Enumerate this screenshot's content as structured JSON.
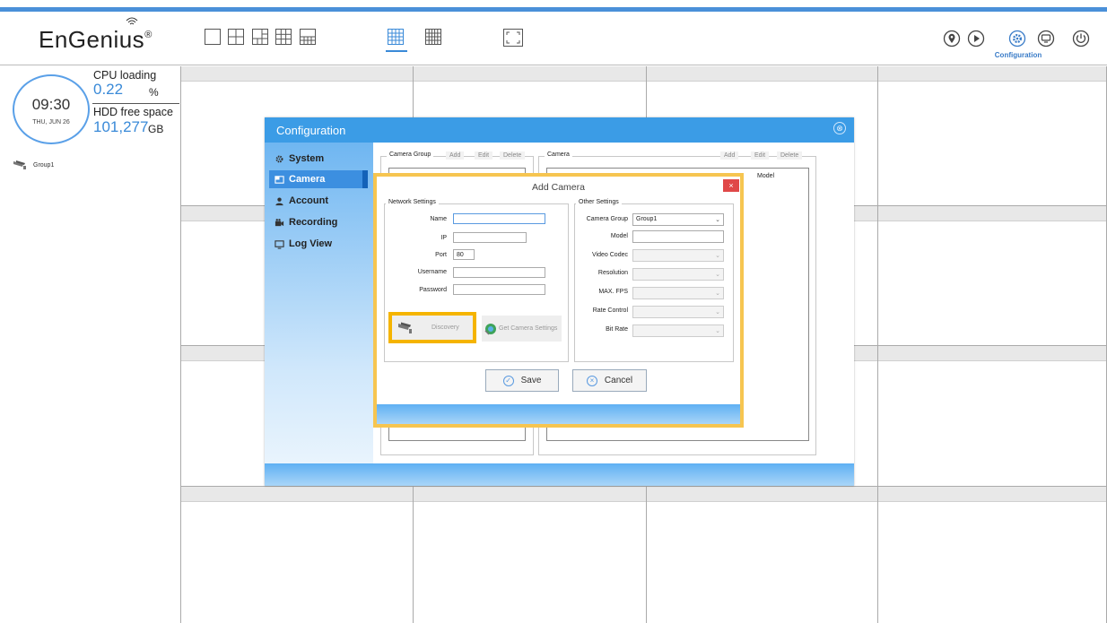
{
  "brand": {
    "name": "EnGenius",
    "mark": "®"
  },
  "layout_buttons": [
    {
      "name": "layout-1x1"
    },
    {
      "name": "layout-2x2"
    },
    {
      "name": "layout-1plus5"
    },
    {
      "name": "layout-3x3"
    },
    {
      "name": "layout-1plus12"
    },
    {
      "name": "layout-4x4",
      "selected": true
    },
    {
      "name": "layout-5x5"
    }
  ],
  "toolbar": {
    "configuration_label": "Configuration",
    "icons": [
      "map-pin-icon",
      "playback-icon",
      "configuration-gear-icon",
      "monitor-icon",
      "power-icon"
    ]
  },
  "clock": {
    "time": "09:30",
    "date": "THU, JUN 26"
  },
  "stats": {
    "cpu_label": "CPU loading",
    "cpu_value": "0.22",
    "cpu_unit": "%",
    "hdd_label": "HDD free space",
    "hdd_value": "101,277",
    "hdd_unit": "GB"
  },
  "sidebar": {
    "groups": [
      {
        "label": "Group1"
      }
    ]
  },
  "config_dialog": {
    "title": "Configuration",
    "close_glyph": "⊗",
    "nav": [
      {
        "label": "System",
        "icon": "gear-icon"
      },
      {
        "label": "Camera",
        "icon": "camera-window-icon",
        "active": true
      },
      {
        "label": "Account",
        "icon": "user-icon"
      },
      {
        "label": "Recording",
        "icon": "recording-icon"
      },
      {
        "label": "Log View",
        "icon": "monitor-icon"
      }
    ],
    "camera_group": {
      "legend": "Camera Group",
      "add": "Add",
      "edit": "Edit",
      "delete": "Delete"
    },
    "camera": {
      "legend": "Camera",
      "add": "Add",
      "edit": "Edit",
      "delete": "Delete",
      "col_model": "Model"
    }
  },
  "add_camera": {
    "title": "Add Camera",
    "close_glyph": "×",
    "network": {
      "legend": "Network Settings",
      "name_label": "Name",
      "name_value": "",
      "ip_label": "IP",
      "ip_value": "",
      "port_label": "Port",
      "port_value": "80",
      "username_label": "Username",
      "username_value": "",
      "password_label": "Password",
      "password_value": ""
    },
    "other": {
      "legend": "Other Settings",
      "camera_group_label": "Camera Group",
      "camera_group_value": "Group1",
      "model_label": "Model",
      "model_value": "",
      "video_codec_label": "Video Codec",
      "resolution_label": "Resolution",
      "max_fps_label": "MAX. FPS",
      "rate_control_label": "Rate Control",
      "bit_rate_label": "Bit Rate"
    },
    "discovery_label": "Discovery",
    "get_settings_label": "Get Camera Settings",
    "save_label": "Save",
    "cancel_label": "Cancel"
  },
  "colors": {
    "accent": "#3a8ad8",
    "dialog_header": "#3b9ce6",
    "highlight": "#f5b400",
    "close_red": "#e04848"
  }
}
